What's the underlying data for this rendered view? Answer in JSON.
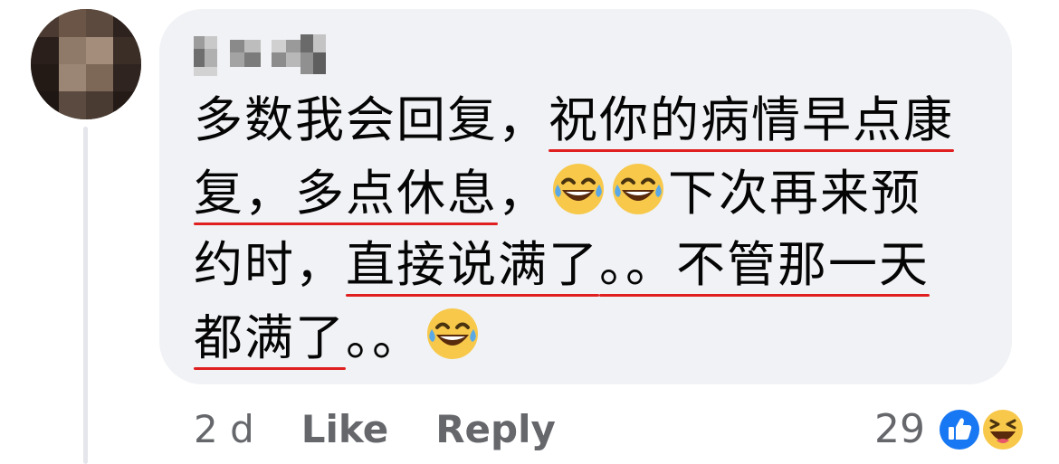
{
  "comment": {
    "lines": [
      {
        "parts": [
          "多数我会回复，",
          "祝你的病情早点康"
        ]
      },
      {
        "parts": [
          "复，多点休息",
          "，",
          "下次再来预"
        ]
      },
      {
        "parts": [
          "约时，",
          "直接说满了",
          "。。不管那一天"
        ]
      },
      {
        "parts": [
          "都满了",
          "。。"
        ]
      }
    ],
    "underline_color": "#e02020"
  },
  "footer": {
    "time": "2 d",
    "like_label": "Like",
    "reply_label": "Reply",
    "reaction_count": "29",
    "reaction_icons": [
      "like-icon",
      "haha-icon"
    ]
  },
  "colors": {
    "bubble": "#f0f2f5",
    "meta_text": "#65676b",
    "like_blue": "#1877f2",
    "haha_yellow": "#f7c84a"
  }
}
